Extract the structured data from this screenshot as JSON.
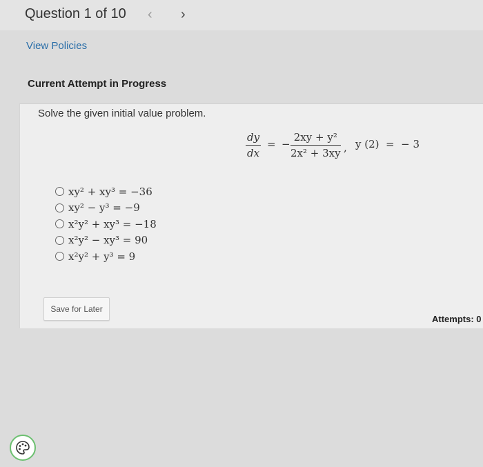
{
  "header": {
    "question_label": "Question 1 of 10",
    "prev_icon": "‹",
    "next_icon": "›"
  },
  "links": {
    "view_policies": "View Policies"
  },
  "attempt": {
    "title": "Current Attempt in Progress"
  },
  "problem": {
    "prompt": "Solve the given initial value problem.",
    "equation": {
      "lhs_num": "dy",
      "lhs_den": "dx",
      "equals": "=",
      "minus": "−",
      "rhs_num": "2xy + y²",
      "rhs_den": "2x² + 3xy",
      "comma": ",",
      "condition": "y (2)  =  − 3"
    }
  },
  "choices": [
    "xy² + xy³  =  −36",
    "xy² − y³  =  −9",
    "x²y² + xy³  =  −18",
    "x²y² − xy³  =  90",
    "x²y² + y³  =  9"
  ],
  "actions": {
    "save_for_later": "Save for Later"
  },
  "attempts": {
    "label": "Attempts:",
    "count": "0"
  },
  "colors": {
    "link": "#2a6ea8",
    "help_ring": "#6cc070"
  }
}
